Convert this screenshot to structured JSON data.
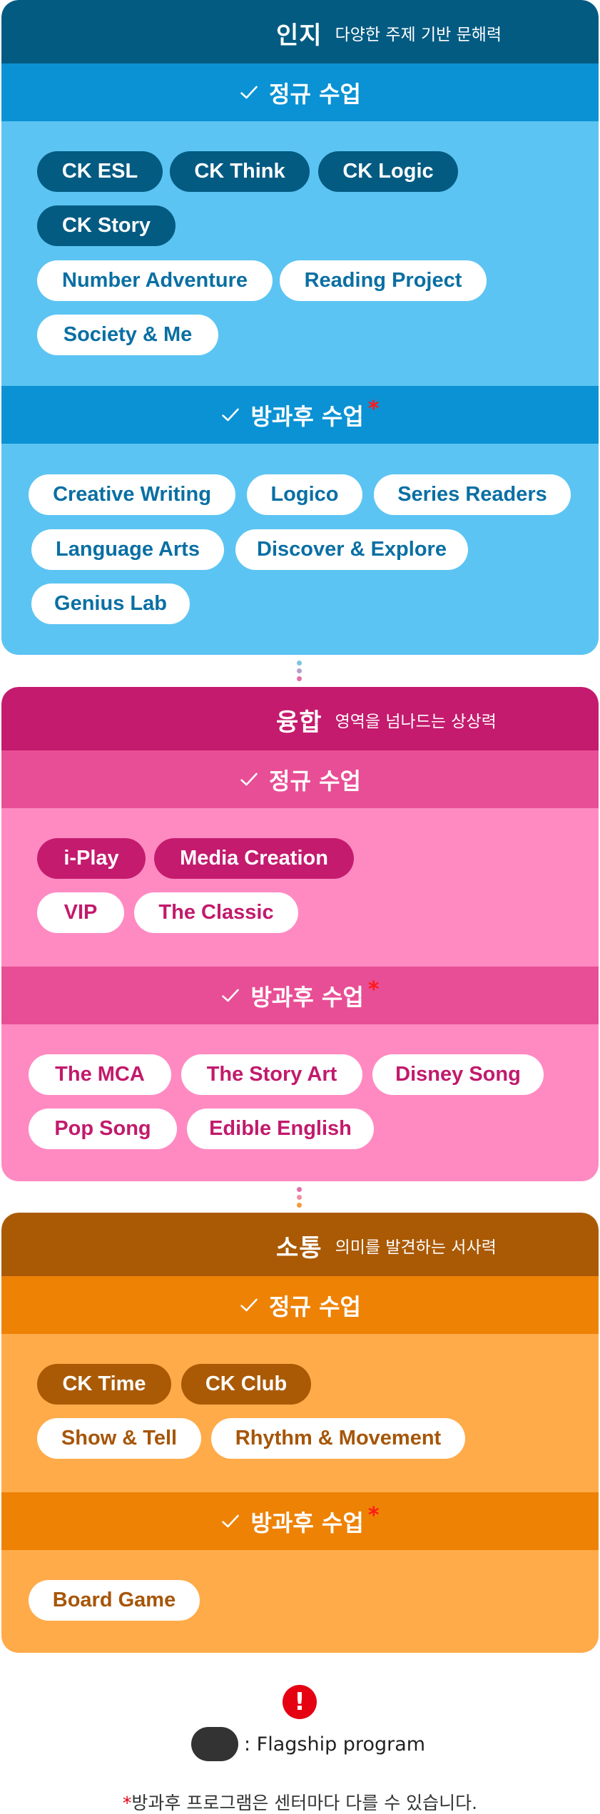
{
  "sections": {
    "cognitive": {
      "title": "인지",
      "subtitle": "다양한 주제 기반 문해력",
      "regular_label": "정규 수업",
      "after_label": "방과후 수업",
      "after_mark": "*",
      "regular_flagship": [
        "CK ESL",
        "CK Think",
        "CK Logic",
        "CK Story"
      ],
      "regular_normal": [
        "Number Adventure",
        "Reading Project",
        "Society & Me"
      ],
      "after_normal": [
        "Creative Writing",
        "Logico",
        "Series Readers",
        "Language Arts",
        "Discover & Explore",
        "Genius Lab"
      ]
    },
    "convergence": {
      "title": "융합",
      "subtitle": "영역을 넘나드는 상상력",
      "regular_label": "정규 수업",
      "after_label": "방과후 수업",
      "after_mark": "*",
      "regular_flagship": [
        "i-Play",
        "Media Creation"
      ],
      "regular_normal": [
        "VIP",
        "The Classic"
      ],
      "after_normal": [
        "The MCA",
        "The Story Art",
        "Disney Song",
        "Pop Song",
        "Edible English"
      ]
    },
    "communication": {
      "title": "소통",
      "subtitle": "의미를 발견하는 서사력",
      "regular_label": "정규 수업",
      "after_label": "방과후 수업",
      "after_mark": "*",
      "regular_flagship": [
        "CK Time",
        "CK Club"
      ],
      "regular_normal": [
        "Show & Tell",
        "Rhythm & Movement"
      ],
      "after_normal": [
        "Board Game"
      ]
    }
  },
  "legend": {
    "alert_glyph": "!",
    "flagship_text": ": Flagship program",
    "footnote_mark": "*",
    "footnote_text": "방과후 프로그램은 센터마다 다를 수 있습니다."
  },
  "colors": {
    "cognitive_dark": "#035b82",
    "cognitive_light": "#5cc4f2",
    "convergence_dark": "#c41b6e",
    "convergence_light": "#ff8ac2",
    "communication_dark": "#aa5a05",
    "communication_light": "#ffab4a",
    "alert_red": "#e50012"
  }
}
